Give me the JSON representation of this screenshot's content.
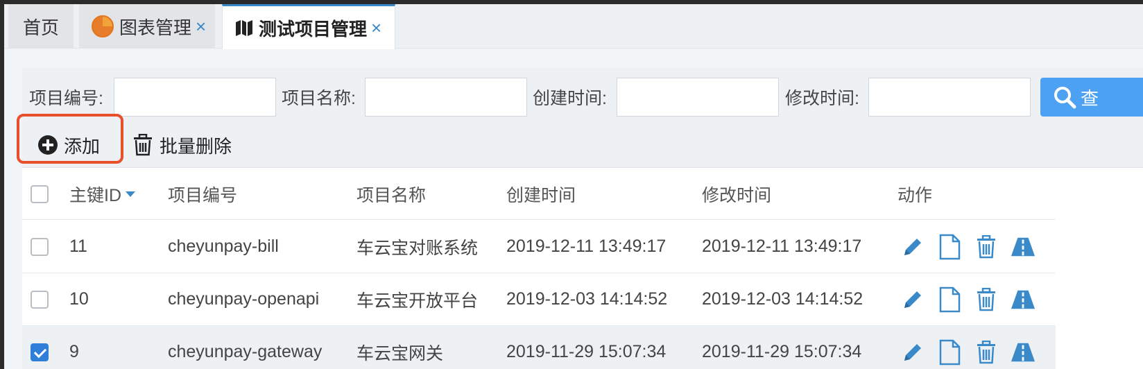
{
  "tabs": {
    "home": "首页",
    "chart": "图表管理",
    "chart_icon": "pie-chart-icon",
    "project": "测试项目管理",
    "project_icon": "map-icon",
    "close_glyph": "×"
  },
  "search": {
    "fields": [
      {
        "label": "项目编号:",
        "value": ""
      },
      {
        "label": "项目名称:",
        "value": ""
      },
      {
        "label": "创建时间:",
        "value": ""
      },
      {
        "label": "修改时间:",
        "value": ""
      }
    ],
    "button_label": "查",
    "button_icon": "search-icon"
  },
  "toolbar": {
    "add_label": "添加",
    "add_icon": "plus-circle-icon",
    "batch_delete_label": "批量删除",
    "batch_delete_icon": "trash-icon"
  },
  "table": {
    "columns": [
      "主键ID",
      "项目编号",
      "项目名称",
      "创建时间",
      "修改时间",
      "动作"
    ],
    "sort_column": "主键ID",
    "sort_direction": "desc",
    "rows": [
      {
        "id": "11",
        "code": "cheyunpay-bill",
        "name": "车云宝对账系统",
        "created": "2019-12-11 13:49:17",
        "modified": "2019-12-11 13:49:17",
        "checked": false
      },
      {
        "id": "10",
        "code": "cheyunpay-openapi",
        "name": "车云宝开放平台",
        "created": "2019-12-03 14:14:52",
        "modified": "2019-12-03 14:14:52",
        "checked": false
      },
      {
        "id": "9",
        "code": "cheyunpay-gateway",
        "name": "车云宝网关",
        "created": "2019-11-29 15:07:34",
        "modified": "2019-11-29 15:07:34",
        "checked": true
      }
    ],
    "action_icons": [
      "pencil-icon",
      "file-icon",
      "trash-icon",
      "road-icon"
    ]
  },
  "colors": {
    "accent": "#3a89c9",
    "search_button": "#4da1f2",
    "highlight_border": "#e8502b",
    "tab_pie": "#e77d2a"
  }
}
